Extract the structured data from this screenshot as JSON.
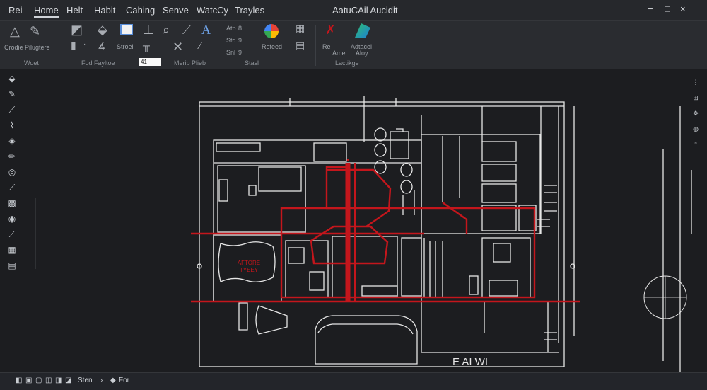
{
  "menu": {
    "tabs": [
      {
        "label": "Rei"
      },
      {
        "label": "Home"
      },
      {
        "label": "Helt"
      },
      {
        "label": "Habit"
      },
      {
        "label": "Cahing"
      },
      {
        "label": "Senve"
      },
      {
        "label": "WatcCy"
      },
      {
        "label": "Trayles"
      }
    ],
    "title": "AatuCAil Aucidit",
    "window_buttons": [
      "−",
      "□",
      "×"
    ]
  },
  "ribbon": {
    "label_draw": "Crodie Pilugtere",
    "label_stroke": "Stroel",
    "label_rotate": "Rofeed",
    "label_meas1": "Re",
    "label_meas2": "Ame",
    "label_manage1": "Adtacel",
    "label_manage2": "Aloy",
    "num_a": "8",
    "num_b": "9",
    "num_c": "9",
    "small_a": "Atp",
    "small_b": "Stq",
    "small_c": "Snl",
    "group_labels": [
      "Woet",
      "Fod Fayltoe",
      "Merib Plieb",
      "Stasl",
      "Lactikge"
    ],
    "field_value": "41"
  },
  "drawing": {
    "red_label_1": "AFTORE",
    "red_label_2": "TYEEY",
    "bottom_label": "E    AI    WI"
  },
  "status": {
    "items": [
      {
        "label": "Sten"
      },
      {
        "label": "For"
      }
    ]
  },
  "colors": {
    "canvas": "#1c1d20",
    "line": "#e6e6e6",
    "accent": "#c4161c"
  }
}
